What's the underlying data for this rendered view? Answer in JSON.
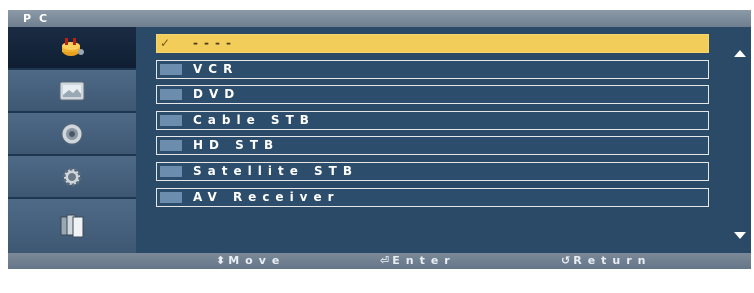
{
  "window": {
    "title": "PC"
  },
  "sidebar": {
    "items": [
      {
        "icon": "input-plug-icon",
        "active": true
      },
      {
        "icon": "picture-icon",
        "active": false
      },
      {
        "icon": "sound-icon",
        "active": false
      },
      {
        "icon": "setup-gear-icon",
        "active": false
      },
      {
        "icon": "multi-screen-icon",
        "active": false
      }
    ]
  },
  "list": {
    "items": [
      {
        "label": "----",
        "selected": true,
        "check": "✓"
      },
      {
        "label": "VCR",
        "selected": false
      },
      {
        "label": "DVD",
        "selected": false
      },
      {
        "label": "Cable STB",
        "selected": false
      },
      {
        "label": "HD STB",
        "selected": false
      },
      {
        "label": "Satellite STB",
        "selected": false
      },
      {
        "label": "AV Receiver",
        "selected": false
      }
    ]
  },
  "footer": {
    "move": "Move",
    "enter": "Enter",
    "return": "Return"
  },
  "colors": {
    "background": "#2a4a68",
    "highlight": "#f2cd5a",
    "tab": "#6c8dae"
  }
}
